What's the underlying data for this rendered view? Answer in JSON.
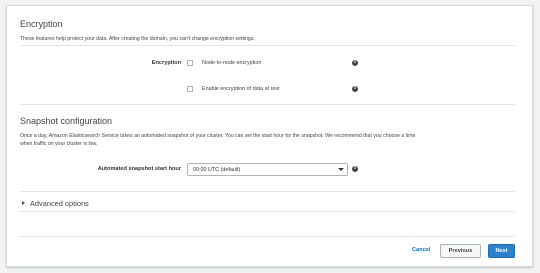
{
  "encryption": {
    "title": "Encryption",
    "description": "These features help protect your data. After creating the domain, you can't change encryption settings.",
    "field_label": "Encryption",
    "options": [
      {
        "label": "Node-to-node encryption",
        "checked": false
      },
      {
        "label": "Enable encryption of data at rest",
        "checked": false
      }
    ]
  },
  "snapshot": {
    "title": "Snapshot configuration",
    "description_line1": "Once a day, Amazon Elasticsearch Service takes an automated snapshot of your cluster. You can set the start hour for the snapshot. We recommend that you choose a time",
    "description_line2": "when traffic on your cluster is low.",
    "field_label": "Automated snapshot start hour",
    "selected_value": "00:00 UTC (default)"
  },
  "advanced": {
    "label": "Advanced options",
    "expanded": false
  },
  "footer": {
    "cancel_label": "Cancel",
    "previous_label": "Previous",
    "next_label": "Next"
  },
  "icons": {
    "info": "info-icon",
    "info_glyph": "i"
  },
  "colors": {
    "primary_button": "#2d7fcf",
    "link": "#0073bb",
    "border": "#d5dbdb"
  }
}
